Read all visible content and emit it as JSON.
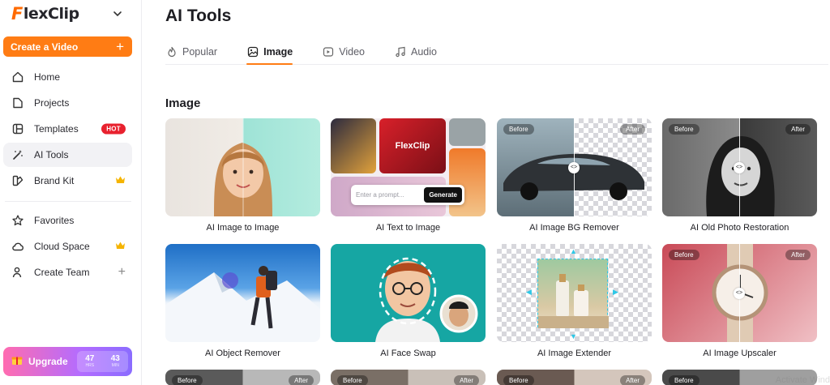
{
  "brand": {
    "name": "lexClip",
    "mark": "F"
  },
  "sidebar": {
    "create_label": "Create a Video",
    "create_plus": "+",
    "items": [
      {
        "label": "Home"
      },
      {
        "label": "Projects"
      },
      {
        "label": "Templates",
        "badge": "HOT"
      },
      {
        "label": "AI Tools"
      },
      {
        "label": "Brand Kit"
      },
      {
        "label": "Favorites"
      },
      {
        "label": "Cloud Space"
      },
      {
        "label": "Create Team",
        "plus": "+"
      }
    ],
    "upgrade": {
      "label": "Upgrade",
      "hours": "47",
      "hours_unit": "HRS",
      "minutes": "43",
      "minutes_unit": "MIN"
    }
  },
  "main": {
    "title": "AI Tools",
    "tabs": [
      {
        "label": "Popular"
      },
      {
        "label": "Image"
      },
      {
        "label": "Video"
      },
      {
        "label": "Audio"
      }
    ],
    "section_title": "Image",
    "prompt_placeholder": "Enter a prompt...",
    "generate_label": "Generate",
    "thumb_brand": "FlexClip",
    "before_label": "Before",
    "after_label": "After",
    "cards": [
      {
        "title": "AI Image to Image"
      },
      {
        "title": "AI Text to Image"
      },
      {
        "title": "AI Image BG Remover"
      },
      {
        "title": "AI Old Photo Restoration"
      },
      {
        "title": "AI Object Remover"
      },
      {
        "title": "AI Face Swap"
      },
      {
        "title": "AI Image Extender"
      },
      {
        "title": "AI Image Upscaler"
      }
    ],
    "watermark": "Activate Wind"
  },
  "colors": {
    "accent": "#ff7c14",
    "hot": "#e8212e",
    "crown": "#f5b400"
  }
}
